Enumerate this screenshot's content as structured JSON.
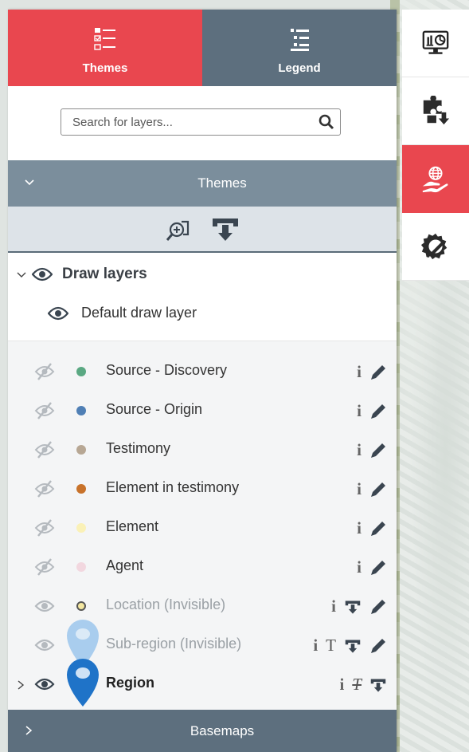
{
  "panel": {
    "tabs": [
      {
        "label": "Themes",
        "active": true
      },
      {
        "label": "Legend",
        "active": false
      }
    ],
    "search": {
      "placeholder": "Search for layers...",
      "value": ""
    },
    "themes_header": "Themes",
    "basemaps_header": "Basemaps",
    "draw_group": {
      "label": "Draw layers",
      "child": "Default draw layer"
    },
    "layers": [
      {
        "label": "Source - Discovery",
        "color": "#5aa882",
        "visible": false
      },
      {
        "label": "Source - Origin",
        "color": "#4f7fb5",
        "visible": false
      },
      {
        "label": "Testimony",
        "color": "#b7a794",
        "visible": false
      },
      {
        "label": "Element in testimony",
        "color": "#c8722a",
        "visible": false
      },
      {
        "label": "Element",
        "color": "#faf1b7",
        "visible": false
      },
      {
        "label": "Agent",
        "color": "#f2d7df",
        "visible": false
      },
      {
        "label": "Location (Invisible)",
        "color": "#f4e7a0",
        "visible": true
      },
      {
        "label": "Sub-region (Invisible)",
        "color": "#7eb4e3",
        "visible": true
      },
      {
        "label": "Region",
        "color": "#1f73c8",
        "visible": true
      }
    ]
  },
  "colors": {
    "accent": "#e9474f",
    "legend_tab": "#5d6f7e",
    "header": "#7b8e9c"
  },
  "toolbar": {
    "buttons": [
      "dashboard-icon",
      "puzzle-download-icon",
      "globe-hand-icon",
      "gear-pencil-icon"
    ],
    "active_index": 2
  }
}
